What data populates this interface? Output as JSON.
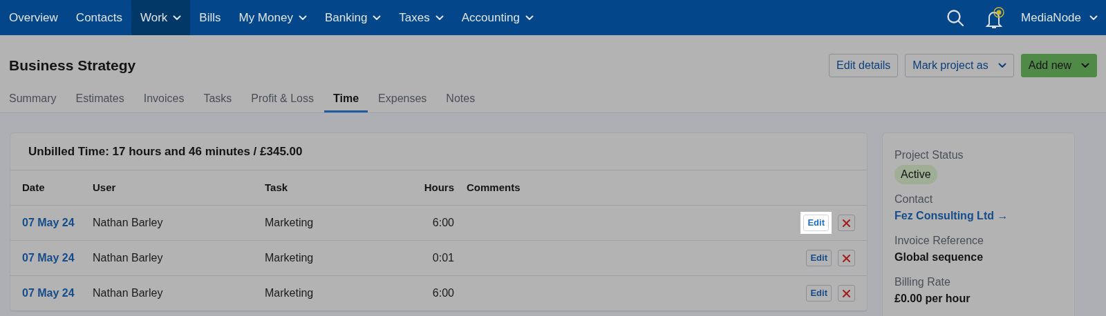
{
  "nav": {
    "items": [
      {
        "label": "Overview",
        "selected": false,
        "dropdown": false
      },
      {
        "label": "Contacts",
        "selected": false,
        "dropdown": false
      },
      {
        "label": "Work",
        "selected": true,
        "dropdown": true
      },
      {
        "label": "Bills",
        "selected": false,
        "dropdown": false
      },
      {
        "label": "My Money",
        "selected": false,
        "dropdown": true
      },
      {
        "label": "Banking",
        "selected": false,
        "dropdown": true
      },
      {
        "label": "Taxes",
        "selected": false,
        "dropdown": true
      },
      {
        "label": "Accounting",
        "selected": false,
        "dropdown": true
      }
    ],
    "account": "MediaNode"
  },
  "page": {
    "title": "Business Strategy",
    "actions": [
      {
        "label": "Edit details",
        "kind": "outline",
        "dropdown": false
      },
      {
        "label": "Mark project as",
        "kind": "outline",
        "dropdown": true
      },
      {
        "label": "Add new",
        "kind": "primary",
        "dropdown": true
      }
    ]
  },
  "tabs": [
    {
      "label": "Summary",
      "selected": false
    },
    {
      "label": "Estimates",
      "selected": false
    },
    {
      "label": "Invoices",
      "selected": false
    },
    {
      "label": "Tasks",
      "selected": false
    },
    {
      "label": "Profit & Loss",
      "selected": false
    },
    {
      "label": "Time",
      "selected": true
    },
    {
      "label": "Expenses",
      "selected": false
    },
    {
      "label": "Notes",
      "selected": false
    }
  ],
  "time_card": {
    "title": "Unbilled Time: 17 hours and 46 minutes / £345.00",
    "columns": [
      "Date",
      "User",
      "Task",
      "Hours",
      "Comments"
    ],
    "rows": [
      {
        "date": "07 May 24",
        "user": "Nathan Barley",
        "task": "Marketing",
        "hours": "6:00",
        "edit": "Edit",
        "highlighted": true
      },
      {
        "date": "07 May 24",
        "user": "Nathan Barley",
        "task": "Marketing",
        "hours": "0:01",
        "edit": "Edit",
        "highlighted": false
      },
      {
        "date": "07 May 24",
        "user": "Nathan Barley",
        "task": "Marketing",
        "hours": "6:00",
        "edit": "Edit",
        "highlighted": false
      }
    ]
  },
  "sidebar": {
    "status_label": "Project Status",
    "status": "Active",
    "contact_label": "Contact",
    "contact": "Fez Consulting Ltd →",
    "invoice_label": "Invoice Reference",
    "invoice": "Global sequence",
    "rate_label": "Billing Rate",
    "rate": "£0.00 per hour"
  }
}
